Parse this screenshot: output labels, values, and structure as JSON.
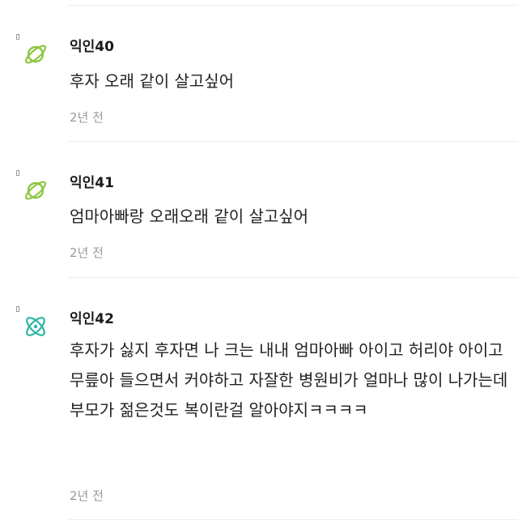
{
  "comments": [
    {
      "author": "익인40",
      "text": "후자 오래 같이 살고싶어",
      "time": "2년 전",
      "avatar_icon": "planet-icon",
      "avatar_color": "#8cc63f"
    },
    {
      "author": "익인41",
      "text": "엄마아빠랑 오래오래 같이 살고싶어",
      "time": "2년 전",
      "avatar_icon": "planet-icon",
      "avatar_color": "#8cc63f"
    },
    {
      "author": "익인42",
      "text": "후자가 싫지 후자면 나 크는 내내 엄마아빠 아이고 허리야 아이고 무릎아 들으면서 커야하고 자잘한 병원비가 얼마나 많이 나가는데 부모가 젊은것도 복이란걸 알아야지ㅋㅋㅋㅋ",
      "time": "2년 전",
      "avatar_icon": "atom-icon",
      "avatar_color": "#2ab5a5"
    }
  ]
}
